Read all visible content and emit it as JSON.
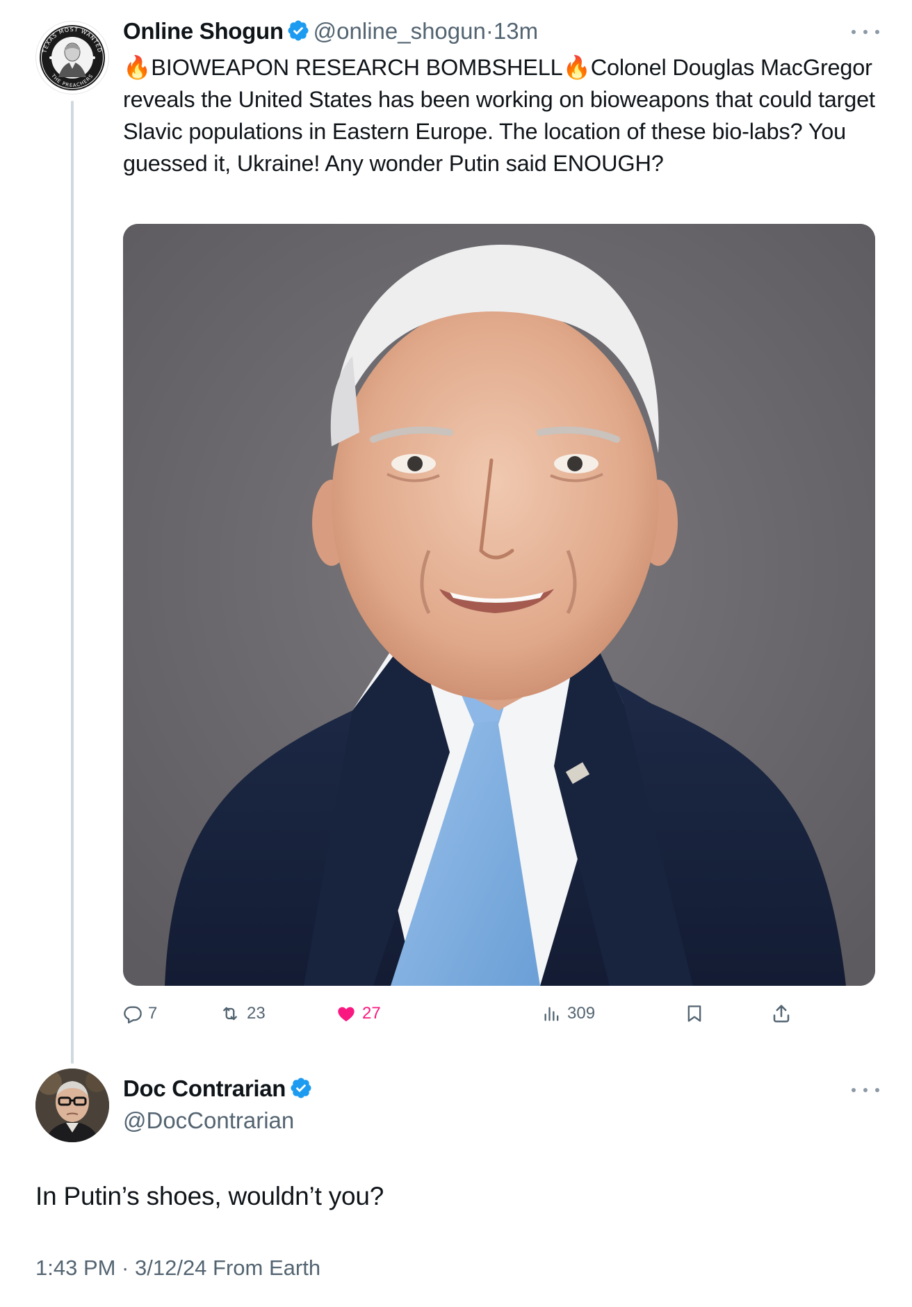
{
  "parent_tweet": {
    "author_name": "Online Shogun",
    "handle": "@online_shogun",
    "separator": "·",
    "age": "13m",
    "avatar_icon": "texas-seal-avatar",
    "avatar_seal_text_top": "TEXAS MOST WANTED",
    "avatar_seal_text_bottom": "THE PREACHERS",
    "text_emoji_1": "🔥",
    "text_part_1": "BIOWEAPON RESEARCH BOMBSHELL",
    "text_emoji_2": "🔥",
    "text_part_2": "Colonel Douglas MacGregor reveals the United States has been working on bioweapons that could target Slavic populations in Eastern Europe. The location of these bio-labs? You guessed it, Ukraine! Any wonder Putin said ENOUGH?",
    "media": "portrait-photo",
    "stats": {
      "replies": "7",
      "reposts": "23",
      "likes": "27",
      "views": "309"
    },
    "colors": {
      "like_active": "#f91880",
      "verified": "#1d9bf0",
      "secondary_text": "#536471"
    }
  },
  "reply_tweet": {
    "author_name": "Doc Contrarian",
    "handle": "@DocContrarian",
    "avatar_icon": "doc-contrarian-avatar",
    "text": "In Putin’s shoes, wouldn’t you?",
    "timestamp": "1:43 PM · 3/12/24 From Earth"
  }
}
